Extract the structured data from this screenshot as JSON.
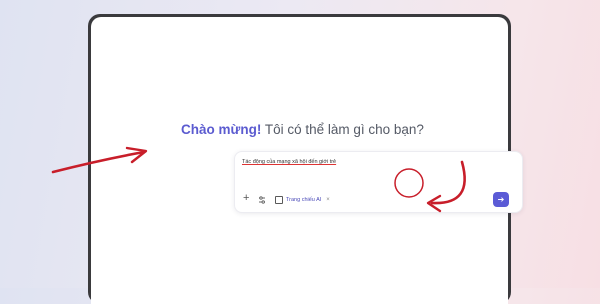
{
  "greeting": {
    "strong": "Chào mừng!",
    "rest": " Tôi có thể làm gì cho bạn?"
  },
  "prompt": {
    "value": "Tác động của mạng xã hội đến giới trẻ"
  },
  "toolbar": {
    "add_icon": "plus-icon",
    "settings_icon": "sliders-icon",
    "chip_label": "Trang chiếu AI",
    "chip_icon": "slides-icon",
    "chip_close": "×",
    "send_icon": "arrow-right-icon"
  },
  "colors": {
    "accent": "#5b5bd6",
    "annotation": "#c81e2a"
  }
}
